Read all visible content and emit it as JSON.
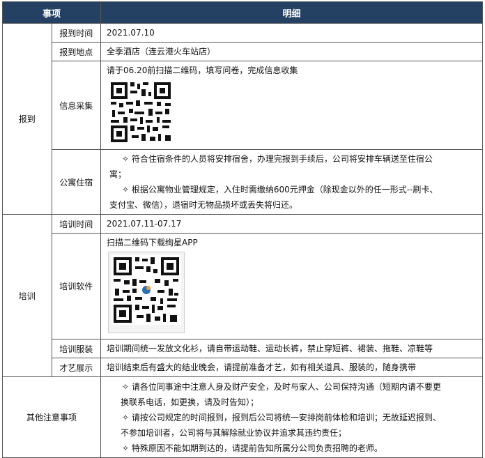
{
  "header": {
    "item": "事项",
    "detail": "明细"
  },
  "sections": {
    "report": {
      "category": "报到",
      "time_label": "报到时间",
      "time_value": "2021.07.10",
      "place_label": "报到地点",
      "place_value": "全季酒店（连云港火车站店）",
      "info_label": "信息采集",
      "info_text": "请于06.20前扫描二维码，填写问卷，完成信息收集",
      "apt_label": "公寓住宿",
      "apt_lines": [
        "✧ 符合住宿条件的人员将安排宿舍，办理完报到手续后，公司将安排车辆送至住宿公",
        "寓；",
        "✧ 根据公寓物业管理规定，入住时需缴纳600元押金（除现金以外的任一形式--刷卡、",
        "支付宝、微信），退宿时无物品损坏或丢失将归还。"
      ]
    },
    "training": {
      "category": "培训",
      "time_label": "培训时间",
      "time_value": "2021.07.11-07.17",
      "software_label": "培训软件",
      "software_text": "扫描二维码下载绚星APP",
      "uniform_label": "培训服装",
      "uniform_value": "培训期间统一发放文化衫，请自带运动鞋、运动长裤，禁止穿短裤、裙装、拖鞋、凉鞋等",
      "talent_label": "才艺展示",
      "talent_value": "培训结束后有盛大的结业晚会，请提前准备才艺，如有相关道具、服装的，随身携带"
    },
    "notes": {
      "category": "其他注意事项",
      "lines": [
        "✧ 请各位同事途中注意人身及财产安全，及时与家人、公司保持沟通（短期内请不要更",
        "换联系电话，如更换，请及时告知）；",
        "✧ 请按公司规定的时间报到，报到后公司将统一安排岗前体检和培训；无故延迟报到、",
        "不参加培训者，公司将与其解除就业协议并追求其违约责任；",
        "✧ 特殊原因不能如期到达的，请提前告知所属分公司负责招聘的老师。"
      ]
    }
  }
}
